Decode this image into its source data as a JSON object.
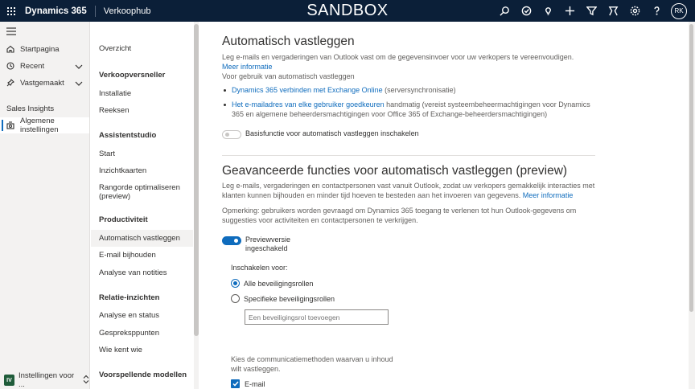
{
  "topbar": {
    "app_name": "Dynamics 365",
    "hub_name": "Verkoophub",
    "environment": "SANDBOX",
    "icons": [
      "search-icon",
      "task-icon",
      "lightbulb-icon",
      "plus-icon",
      "filter-icon",
      "assistant-icon",
      "gear-icon",
      "help-icon"
    ],
    "avatar_initials": "RK",
    "bar_color": "#0b1f38"
  },
  "leftnav": {
    "items": [
      {
        "label": "Startpagina",
        "icon": "home-icon"
      },
      {
        "label": "Recent",
        "icon": "clock-icon"
      },
      {
        "label": "Vastgemaakt",
        "icon": "pin-icon"
      }
    ],
    "group_label": "Sales Insights",
    "active_item": {
      "label": "Algemene instellingen",
      "icon": "settings-icon"
    },
    "area": {
      "badge": "IV",
      "label": "Instellingen voor ..."
    }
  },
  "settings_menu": {
    "overview": "Overzicht",
    "sections": [
      {
        "heading": "Verkoopversneller",
        "items": [
          "Installatie",
          "Reeksen"
        ]
      },
      {
        "heading": "Assistentstudio",
        "items": [
          "Start",
          "Inzichtkaarten",
          "Rangorde optimaliseren (preview)"
        ]
      },
      {
        "heading": "Productiviteit",
        "items": [
          "Automatisch vastleggen",
          "E-mail bijhouden",
          "Analyse van notities"
        ]
      },
      {
        "heading": "Relatie-inzichten",
        "items": [
          "Analyse en status",
          "Gespreksppunten",
          "Wie kent wie"
        ]
      },
      {
        "heading": "Voorspellende modellen",
        "items": []
      }
    ],
    "active": "Automatisch vastleggen"
  },
  "main": {
    "title": "Automatisch vastleggen",
    "intro": "Leg e-mails en vergaderingen van Outlook vast om de gegevensinvoer voor uw verkopers te vereenvoudigen.",
    "intro_link": "Meer informatie",
    "usage_label": "Voor gebruik van automatisch vastleggen",
    "bullet1_link": "Dynamics 365 verbinden met Exchange Online",
    "bullet1_text": " (serversynchronisatie)",
    "bullet2_link": "Het e-mailadres van elke gebruiker goedkeuren",
    "bullet2_text": " handmatig (vereist systeembeheermachtigingen voor Dynamics 365 en algemene beheerdersmachtigingen voor Office 365 of Exchange-beheerdersmachtigingen)",
    "basic_toggle_label": "Basisfunctie voor automatisch vastleggen inschakelen",
    "basic_toggle_on": false,
    "advanced_title": "Geavanceerde functies voor automatisch vastleggen (preview)",
    "advanced_desc": "Leg e-mails, vergaderingen en contactpersonen vast vanuit Outlook, zodat uw verkopers gemakkelijk interacties met klanten kunnen bijhouden en minder tijd hoeven te besteden aan het invoeren van gegevens.",
    "advanced_link": "Meer informatie",
    "note": "Opmerking: gebruikers worden gevraagd om Dynamics 365 toegang te verlenen tot hun Outlook-gegevens om suggesties voor activiteiten en contactpersonen te verkrijgen.",
    "preview_toggle_label": "Previewversie ingeschakeld",
    "preview_toggle_on": true,
    "enable_for_label": "Inschakelen voor:",
    "radio_all": "Alle beveiligingsrollen",
    "radio_specific": "Specifieke beveiligingsrollen",
    "selected_radio": "Alle beveiligingsrollen",
    "role_placeholder": "Een beveiligingsrol toevoegen",
    "methods_label": "Kies de communicatiemethoden waarvan u inhoud wilt vastleggen.",
    "checkbox_email": "E-mail",
    "checkbox_email_checked": true,
    "accent_color": "#0f6cbd"
  }
}
